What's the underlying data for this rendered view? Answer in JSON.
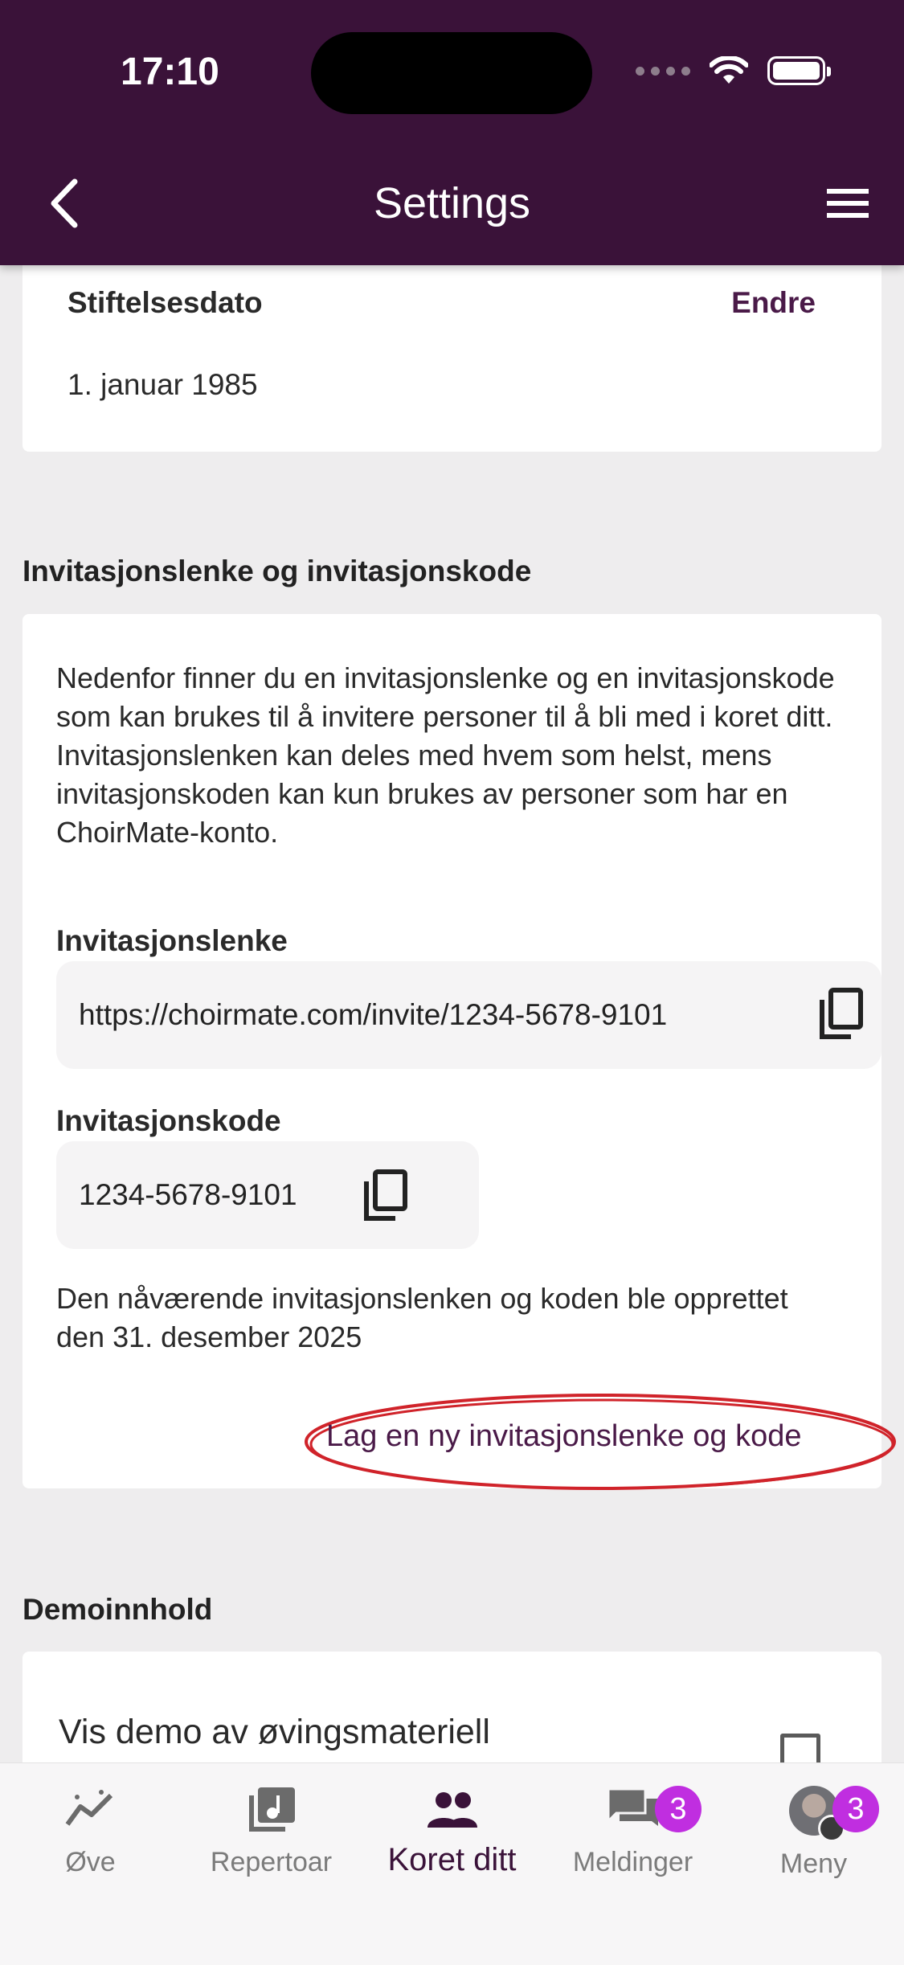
{
  "status": {
    "time": "17:10"
  },
  "nav": {
    "title": "Settings",
    "back_icon": "chevron-left-icon",
    "menu_icon": "hamburger-menu-icon"
  },
  "founding": {
    "label": "Stiftelsesdato",
    "edit": "Endre",
    "value": "1. januar 1985"
  },
  "invite": {
    "section_title": "Invitasjonslenke og invitasjonskode",
    "description": "Nedenfor finner du en invitasjonslenke og en invitasjonskode som kan brukes til å invitere personer til å bli med i koret ditt. Invitasjonslenken kan deles med hvem som helst, mens invitasjonskoden kan kun brukes av personer som har en ChoirMate-konto.",
    "link_label": "Invitasjonslenke",
    "link_value": "https://choirmate.com/invite/1234-5678-9101",
    "code_label": "Invitasjonskode",
    "code_value": "1234-5678-9101",
    "created_text": "Den nåværende invitasjonslenken og koden ble opprettet den 31. desember 2025",
    "new_button": "Lag en ny invitasjonslenke og kode",
    "highlight_color": "#d0232a"
  },
  "demo": {
    "section_title": "Demoinnhold",
    "toggle_label": "Vis demo av øvingsmateriell",
    "checked": false
  },
  "tabs": [
    {
      "label": "Øve",
      "icon": "practice-chart-icon"
    },
    {
      "label": "Repertoar",
      "icon": "music-library-icon"
    },
    {
      "label": "Koret ditt",
      "icon": "group-icon",
      "active": true
    },
    {
      "label": "Meldinger",
      "icon": "chat-icon",
      "badge": "3"
    },
    {
      "label": "Meny",
      "icon": "avatar-icon",
      "badge": "3"
    }
  ],
  "colors": {
    "header_bg": "#3a1239",
    "accent": "#4a1a48",
    "badge": "#c02ee0"
  }
}
